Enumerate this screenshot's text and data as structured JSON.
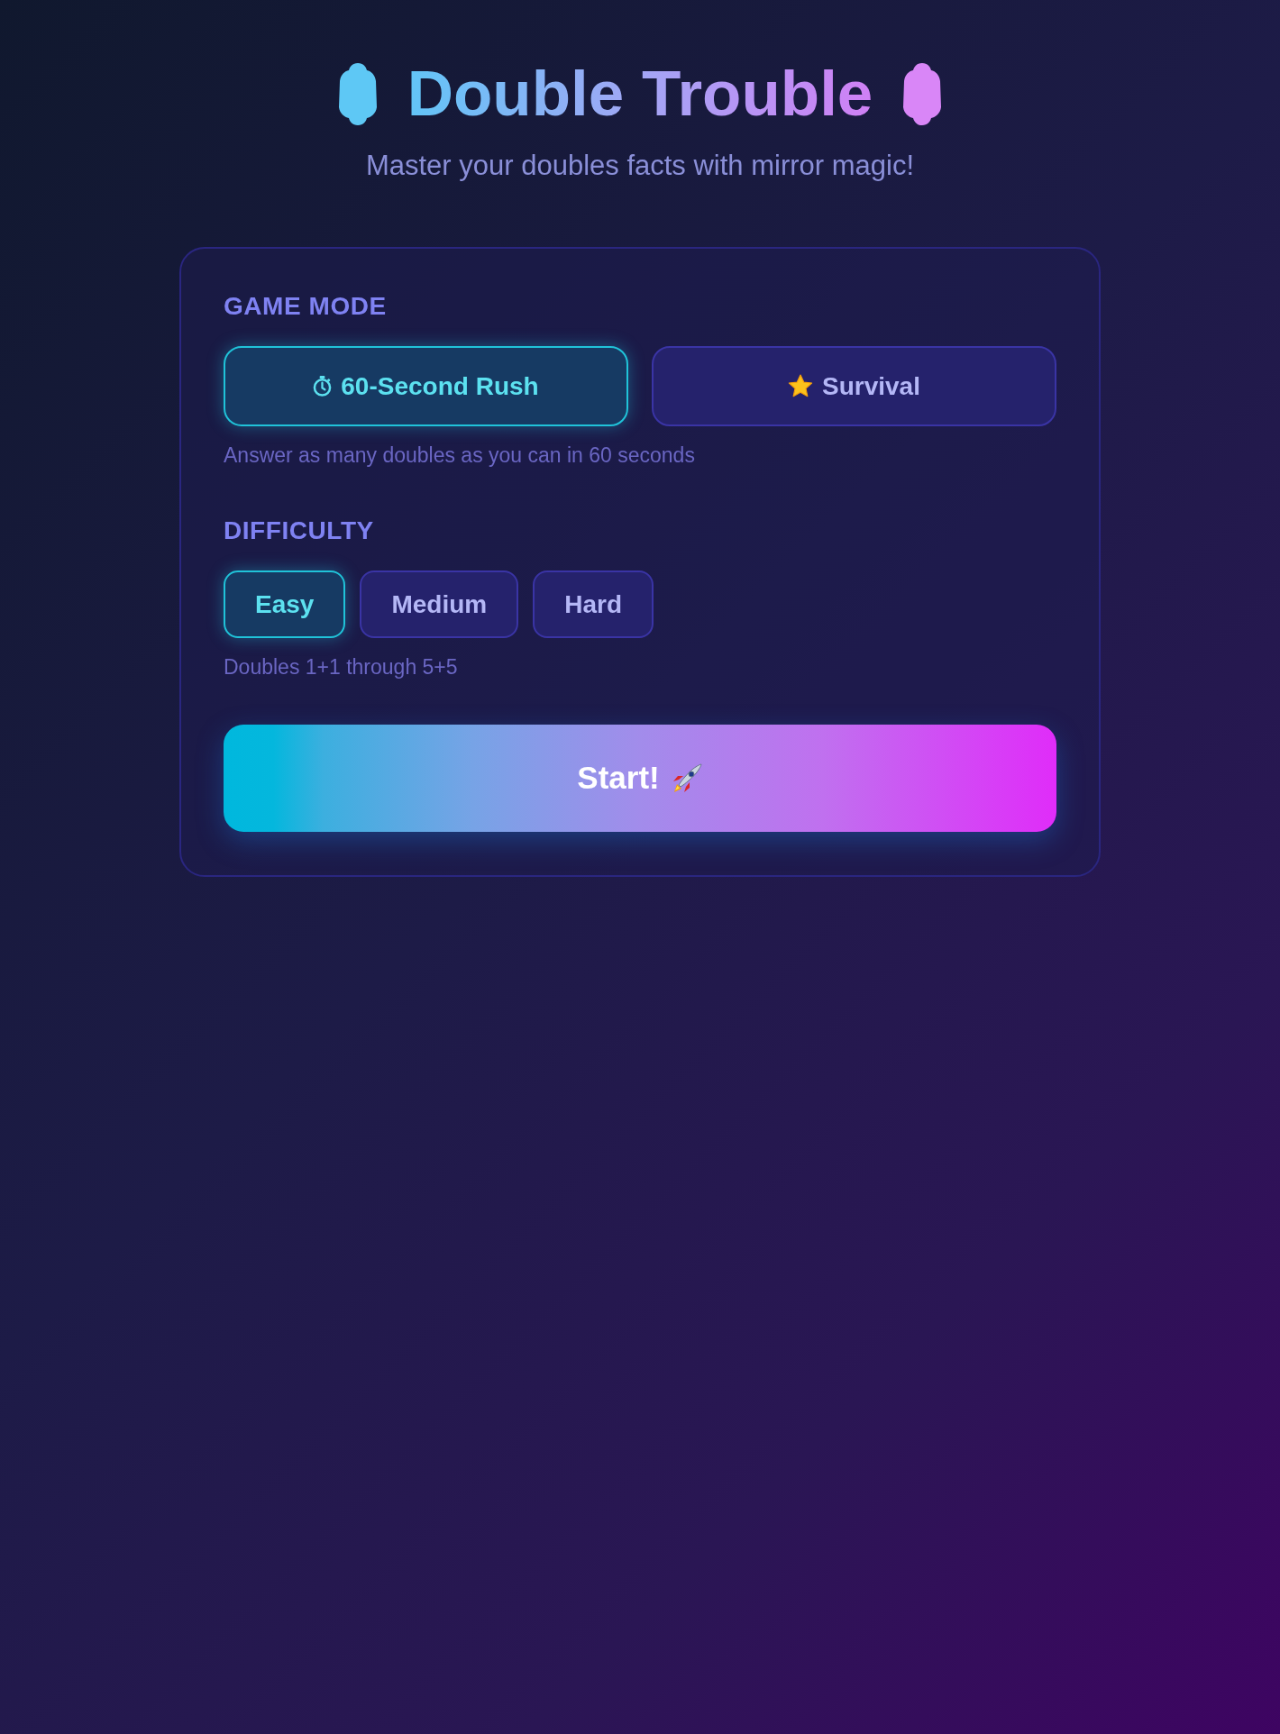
{
  "header": {
    "title": "Double Trouble",
    "subtitle": "Master your doubles facts with mirror magic!"
  },
  "game_mode": {
    "label": "GAME MODE",
    "options": [
      {
        "kind": "timed",
        "label": "60-Second Rush",
        "selected": true
      },
      {
        "kind": "endless",
        "label": "Survival",
        "selected": false
      }
    ],
    "description": "Answer as many doubles as you can in 60 seconds"
  },
  "difficulty": {
    "label": "DIFFICULTY",
    "options": [
      {
        "label": "Easy",
        "selected": true
      },
      {
        "label": "Medium",
        "selected": false
      },
      {
        "label": "Hard",
        "selected": false
      }
    ],
    "description": "Doubles 1+1 through 5+5"
  },
  "start_button": {
    "label": "Start!"
  }
}
